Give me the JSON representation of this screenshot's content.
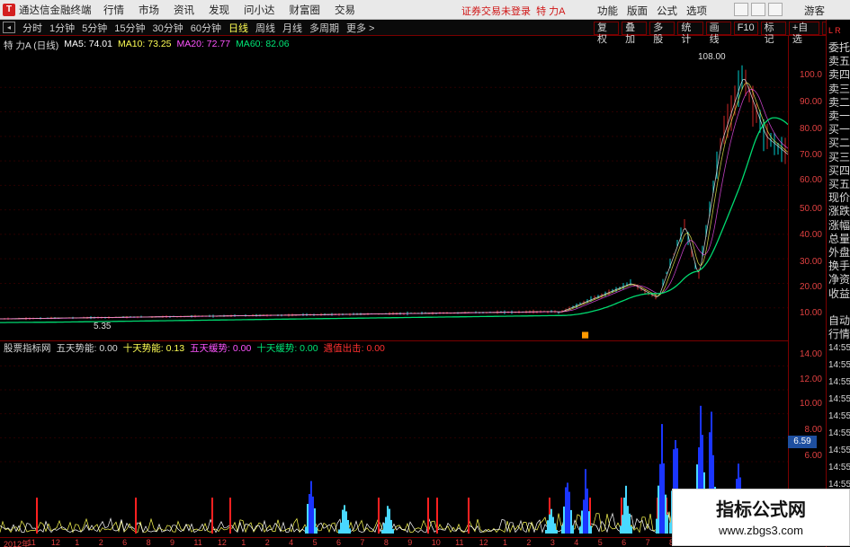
{
  "titlebar": {
    "app_title": "通达信金融终端",
    "menus": [
      "行情",
      "市场",
      "资讯",
      "发现",
      "问小达",
      "财富圈",
      "交易"
    ],
    "trade_status": "证券交易未登录",
    "stock_name": "特 力A",
    "right_menus": [
      "功能",
      "版面",
      "公式",
      "选项"
    ],
    "guest": "游客"
  },
  "periods": {
    "items": [
      "分时",
      "1分钟",
      "5分钟",
      "15分钟",
      "30分钟",
      "60分钟",
      "日线",
      "周线",
      "月线",
      "多周期",
      "更多"
    ],
    "active": "日线"
  },
  "toolbar": {
    "items": [
      "复权",
      "叠加",
      "多股",
      "统计",
      "画线",
      "F10",
      "标记",
      "+自选",
      "返回"
    ]
  },
  "main": {
    "title": "特 力A (日线)",
    "ma5": "MA5: 74.01",
    "ma10": "MA10: 73.25",
    "ma20": "MA20: 72.77",
    "ma60": "MA60: 82.06",
    "high_label": "108.00",
    "low_label": "5.35",
    "yticks": [
      "100.0",
      "90.00",
      "80.00",
      "70.00",
      "60.00",
      "50.00",
      "40.00",
      "30.00",
      "20.00",
      "10.00"
    ]
  },
  "indicator": {
    "name": "股票指标网",
    "v5": "五天势能: 0.00",
    "v10": "十天势能: 0.13",
    "slow5": "五天缓势: 0.00",
    "slow10": "十天缓势: 0.00",
    "signal": "遇值出击: 0.00",
    "yticks": [
      "14.00",
      "12.00",
      "10.00",
      "8.00",
      "6.00"
    ],
    "current_value": "6.59"
  },
  "sidebar": {
    "items": [
      "委托",
      "卖五",
      "卖四",
      "卖三",
      "卖二",
      "卖一",
      "买一",
      "买二",
      "买三",
      "买四",
      "买五",
      "现价",
      "涨跌",
      "涨幅",
      "总量",
      "外盘",
      "换手",
      "净资",
      "收益",
      "自动",
      "行情",
      "14:55",
      "14:55",
      "14:55",
      "14:55",
      "14:55",
      "14:55",
      "14:55",
      "14:55",
      "14:55"
    ]
  },
  "xaxis": {
    "labels": [
      "2012年",
      "11",
      "12",
      "1",
      "2",
      "6",
      "8",
      "9",
      "11",
      "12",
      "1",
      "2",
      "4",
      "5",
      "6",
      "7",
      "8",
      "9",
      "10",
      "11",
      "12",
      "1",
      "2",
      "3",
      "4",
      "5",
      "6",
      "7",
      "8"
    ]
  },
  "colors": {
    "ma5": "#ffffff",
    "ma10": "#ffff54",
    "ma20": "#ff54ff",
    "ma60": "#00e676",
    "rise": "#ff3030",
    "fall": "#00ffff",
    "axis": "#7a0000"
  },
  "watermark": {
    "title": "指标公式网",
    "url": "www.zbgs3.com"
  }
}
